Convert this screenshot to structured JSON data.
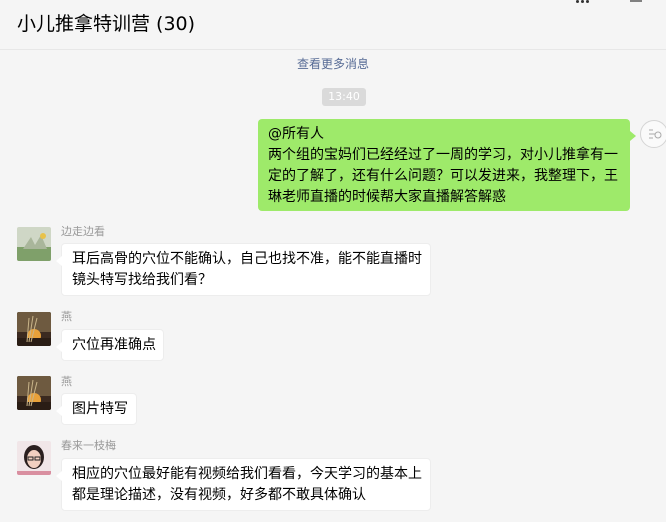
{
  "header": {
    "title": "小儿推拿特训营 (30)"
  },
  "chat": {
    "load_more": "查看更多消息",
    "timestamp": "13:40",
    "messages": [
      {
        "sender": "",
        "self": true,
        "lines": [
          "@所有人",
          "两个组的宝妈们已经经过了一周的学习，对小儿推拿有一",
          "定的了解了，还有什么问题？可以发进来，我整理下，王",
          "琳老师直播的时候帮大家直播解答解惑"
        ],
        "status_icon": "read-receipt-icon"
      },
      {
        "sender": "边走边看",
        "self": false,
        "lines": [
          "耳后高骨的穴位不能确认，自己也找不准，能不能直播时",
          "镜头特写找给我们看？"
        ]
      },
      {
        "sender": "燕",
        "self": false,
        "lines": [
          "穴位再准确点"
        ]
      },
      {
        "sender": "燕",
        "self": false,
        "lines": [
          "图片特写"
        ]
      },
      {
        "sender": "春来一枝梅",
        "self": false,
        "lines": [
          "相应的穴位最好能有视频给我们看看，今天学习的基本上",
          "都是理论描述，没有视频，好多都不敢具体确认"
        ]
      }
    ]
  },
  "colors": {
    "mine_bubble": "#9eea6a",
    "other_bubble": "#ffffff",
    "link": "#576b95",
    "background": "#f5f5f5"
  }
}
